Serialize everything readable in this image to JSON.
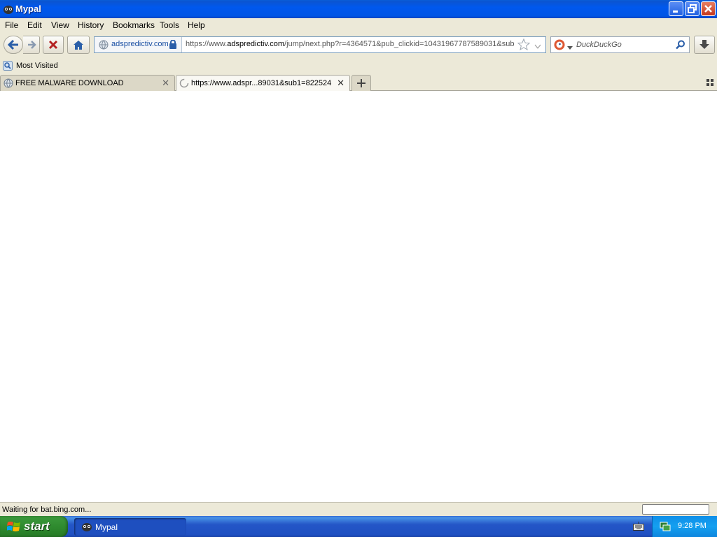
{
  "window": {
    "title": "Mypal"
  },
  "menu": [
    "File",
    "Edit",
    "View",
    "History",
    "Bookmarks",
    "Tools",
    "Help"
  ],
  "navbar": {
    "identity_label": "adspredictiv.com",
    "url_prefix": "https://www.",
    "url_domain": "adspredictiv.com",
    "url_rest": "/jump/next.php?r=4364571&pub_clickid=10431967787589031&sub",
    "search_placeholder": "DuckDuckGo"
  },
  "bookmarks": {
    "most_visited": "Most Visited"
  },
  "tabs": [
    {
      "label": "FREE MALWARE DOWNLOAD"
    },
    {
      "label": "https://www.adspr...89031&sub1=822524"
    }
  ],
  "status": {
    "text": "Waiting for bat.bing.com..."
  },
  "taskbar": {
    "start_label": "start",
    "task_label": "Mypal",
    "clock": "9:28 PM"
  },
  "colors": {
    "titlebar": "#0058ee",
    "chrome": "#ece9d8",
    "taskbar": "#245edb",
    "start": "#2f8b2f"
  }
}
